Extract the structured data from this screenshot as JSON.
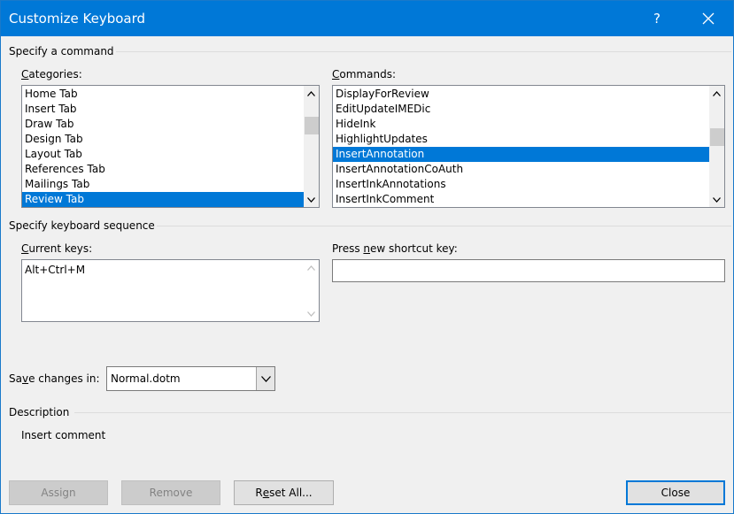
{
  "window": {
    "title": "Customize Keyboard",
    "help": "?"
  },
  "specify_command": {
    "heading": "Specify a command",
    "categories_label_key": "C",
    "categories_label_rest": "ategories:",
    "commands_label_key": "C",
    "commands_label_rest": "ommands:",
    "categories": [
      "Home Tab",
      "Insert Tab",
      "Draw Tab",
      "Design Tab",
      "Layout Tab",
      "References Tab",
      "Mailings Tab",
      "Review Tab"
    ],
    "commands": [
      "DisplayForReview",
      "EditUpdateIMEDic",
      "HideInk",
      "HighlightUpdates",
      "InsertAnnotation",
      "InsertAnnotationCoAuth",
      "InsertInkAnnotations",
      "InsertInkComment"
    ]
  },
  "keyboard_sequence": {
    "heading": "Specify keyboard sequence",
    "current_keys_key": "C",
    "current_keys_rest": "urrent keys:",
    "current_keys_value": "Alt+Ctrl+M",
    "press_new_prefix": "Press ",
    "press_new_key": "n",
    "press_new_rest": "ew shortcut key:"
  },
  "save": {
    "label_pre": "Sa",
    "label_key": "v",
    "label_rest": "e changes in:",
    "value": "Normal.dotm"
  },
  "description": {
    "heading": "Description",
    "text": "Insert comment"
  },
  "buttons": {
    "assign": "Assign",
    "remove": "Remove",
    "reset_pre": "R",
    "reset_key": "e",
    "reset_rest": "set All...",
    "close": "Close"
  }
}
